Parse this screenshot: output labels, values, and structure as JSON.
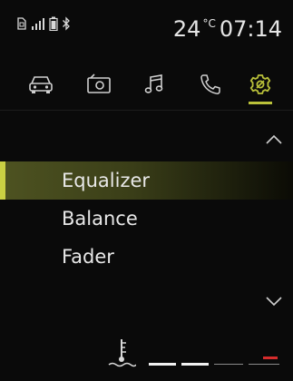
{
  "status": {
    "temperature": "24",
    "temperature_unit": "°C",
    "time": "07:14"
  },
  "tabs": [
    {
      "name": "vehicle",
      "icon": "car-icon"
    },
    {
      "name": "media",
      "icon": "radio-icon"
    },
    {
      "name": "music",
      "icon": "music-note-icon"
    },
    {
      "name": "phone",
      "icon": "phone-icon"
    },
    {
      "name": "settings",
      "icon": "gear-icon",
      "active": true
    }
  ],
  "menu": {
    "items": [
      "Equalizer",
      "Balance",
      "Fader"
    ],
    "selected_index": 0
  },
  "gauge": {
    "icon": "coolant-temperature-icon",
    "level_segments_total": 4,
    "alert_color": "#d62c2c"
  },
  "colors": {
    "accent": "#bac13a",
    "background": "#0a0a0a"
  }
}
